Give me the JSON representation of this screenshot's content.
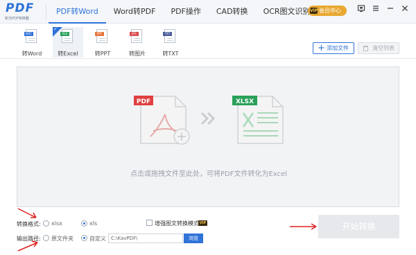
{
  "app": {
    "logo_text": "PDF",
    "logo_sub": "新光PDF转换器"
  },
  "nav": {
    "tabs": [
      {
        "label": "PDF转Word",
        "active": true
      },
      {
        "label": "Word转PDF",
        "active": false
      },
      {
        "label": "PDF操作",
        "active": false
      },
      {
        "label": "CAD转换",
        "active": false
      },
      {
        "label": "OCR图文识别",
        "active": false
      }
    ],
    "vip_label": "会员中心",
    "vip_badge": "VIP"
  },
  "formats": [
    {
      "label": "转Word",
      "band": "DOC",
      "color": "#2f72d8",
      "active": false
    },
    {
      "label": "转Excel",
      "band": "XLS",
      "color": "#2aa05a",
      "active": true
    },
    {
      "label": "转PPT",
      "band": "PPT",
      "color": "#e8743b",
      "active": false
    },
    {
      "label": "转图片",
      "band": "JPG",
      "color": "#d94848",
      "active": false
    },
    {
      "label": "转TXT",
      "band": "TXT",
      "color": "#4a5d9a",
      "active": false
    }
  ],
  "toolbar": {
    "add_file": "添加文件",
    "clear_list": "清空列表"
  },
  "dropzone": {
    "pdf_tag": "PDF",
    "xlsx_tag": "XLSX",
    "hint": "点击或拖拽文件至此处，可将PDF文件转化为Excel"
  },
  "options": {
    "format_label": "转换格式:",
    "format_options": [
      {
        "label": "xlsx",
        "selected": false
      },
      {
        "label": "xls",
        "selected": true
      }
    ],
    "enhance_label": "增强图文转换模式",
    "enhance_vip": "VIP",
    "output_label": "输出路径:",
    "output_options": [
      {
        "label": "原文件夹",
        "selected": false
      },
      {
        "label": "自定义",
        "selected": true
      }
    ],
    "output_path": "C:\\KavPDF\\",
    "browse": "浏览"
  },
  "start_button": "开始转换",
  "colors": {
    "accent": "#2f72d8",
    "pdf_red": "#e04040",
    "excel_green": "#2aa05a",
    "vip_gold": "#e8a832",
    "annotation_red": "#e02020"
  }
}
